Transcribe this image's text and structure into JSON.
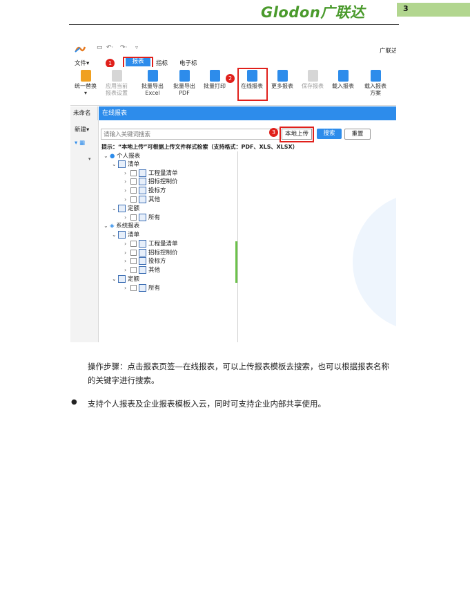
{
  "header": {
    "logo_text": "Glodon广联达",
    "page_number": "3"
  },
  "screenshot": {
    "app_title": "广联达",
    "menu": {
      "file": "文件",
      "report_tab": "报表",
      "index_tab": "指标",
      "ebid_tab": "电子标"
    },
    "ribbon": {
      "unify_replace": "统一替换",
      "apply_current_line1": "应用当前",
      "apply_current_line2": "报表设置",
      "batch_excel_line1": "批量导出",
      "batch_excel_line2": "Excel",
      "batch_pdf_line1": "批量导出",
      "batch_pdf_line2": "PDF",
      "batch_print": "批量打印",
      "online_reports": "在线报表",
      "more_reports": "更多报表",
      "save_report": "保存报表",
      "load_report": "载入报表",
      "load_scheme_line1": "载入报表",
      "load_scheme_line2": "方案"
    },
    "sidebar": {
      "unnamed": "未命名",
      "new": "新建"
    },
    "dialog_title": "在线报表",
    "search": {
      "placeholder": "请输入关键词搜索",
      "local_upload": "本地上传",
      "search_btn": "搜索",
      "reset_btn": "重置",
      "hint": "提示：“本地上传”可根据上传文件样式检索（支持格式：PDF、XLS、XLSX）"
    },
    "tree": {
      "personal": "个人报表",
      "list": "清单",
      "quantity_list": "工程量清单",
      "bid_control_price": "招标控制价",
      "bid_party": "投标方",
      "other": "其他",
      "norm": "定额",
      "all": "所有",
      "system": "系统报表"
    },
    "steps": [
      "1",
      "2",
      "3"
    ]
  },
  "body": {
    "step_text_line1": "操作步骤：点击报表页签—在线报表，可以上传报表模板去搜索，也可以根据报表名称",
    "step_text_line2": "的关键字进行搜索。",
    "bullet": "支持个人报表及企业报表模板入云，同时可支持企业内部共享使用。"
  },
  "colors": {
    "brand_green": "#4a9a2c",
    "accent_blue": "#2d8ceb",
    "step_red": "#e0201b"
  }
}
